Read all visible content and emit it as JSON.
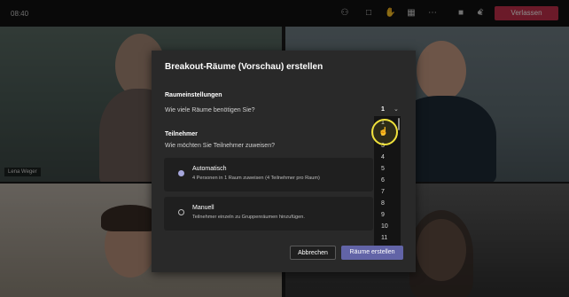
{
  "topbar": {
    "time": "08:40",
    "icons": [
      "people-icon",
      "chat-icon",
      "raise-hand-icon",
      "breakout-icon",
      "more-icon",
      "camera-icon",
      "mic-icon",
      "share-icon"
    ],
    "leave_label": "Verlassen"
  },
  "participants": {
    "tile1_name": "Lena Weger"
  },
  "dialog": {
    "title": "Breakout-Räume (Vorschau) erstellen",
    "room_settings_heading": "Raumeinstellungen",
    "room_count_question": "Wie viele Räume benötigen Sie?",
    "room_count_value": "1",
    "participants_heading": "Teilnehmer",
    "assign_question": "Wie möchten Sie Teilnehmer zuweisen?",
    "option_auto": {
      "title": "Automatisch",
      "subtitle": "4 Personen in 1 Raum zuweisen (4 Teilnehmer pro Raum)",
      "selected": true
    },
    "option_manual": {
      "title": "Manuell",
      "subtitle": "Teilnehmer einzeln zu Gruppenräumen hinzufügen.",
      "selected": false
    },
    "cancel_label": "Abbrechen",
    "create_label": "Räume erstellen"
  },
  "room_dropdown": {
    "options": [
      "1",
      "2",
      "3",
      "4",
      "5",
      "6",
      "7",
      "8",
      "9",
      "10",
      "11"
    ]
  }
}
